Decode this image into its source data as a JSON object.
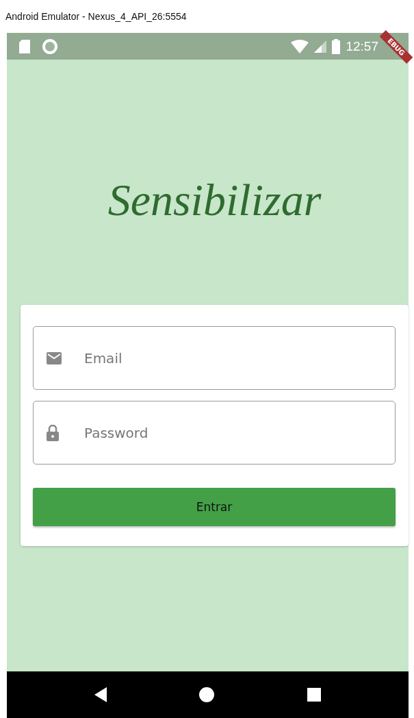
{
  "window": {
    "title": "Android Emulator - Nexus_4_API_26:5554"
  },
  "status_bar": {
    "time": "12:57",
    "debug_banner": "EBUG"
  },
  "logo": {
    "text": "Sensibilizar"
  },
  "form": {
    "fields": [
      {
        "kind": "email",
        "placeholder": "Email"
      },
      {
        "kind": "password",
        "placeholder": "Password"
      }
    ],
    "button": {
      "label": "Entrar"
    }
  }
}
